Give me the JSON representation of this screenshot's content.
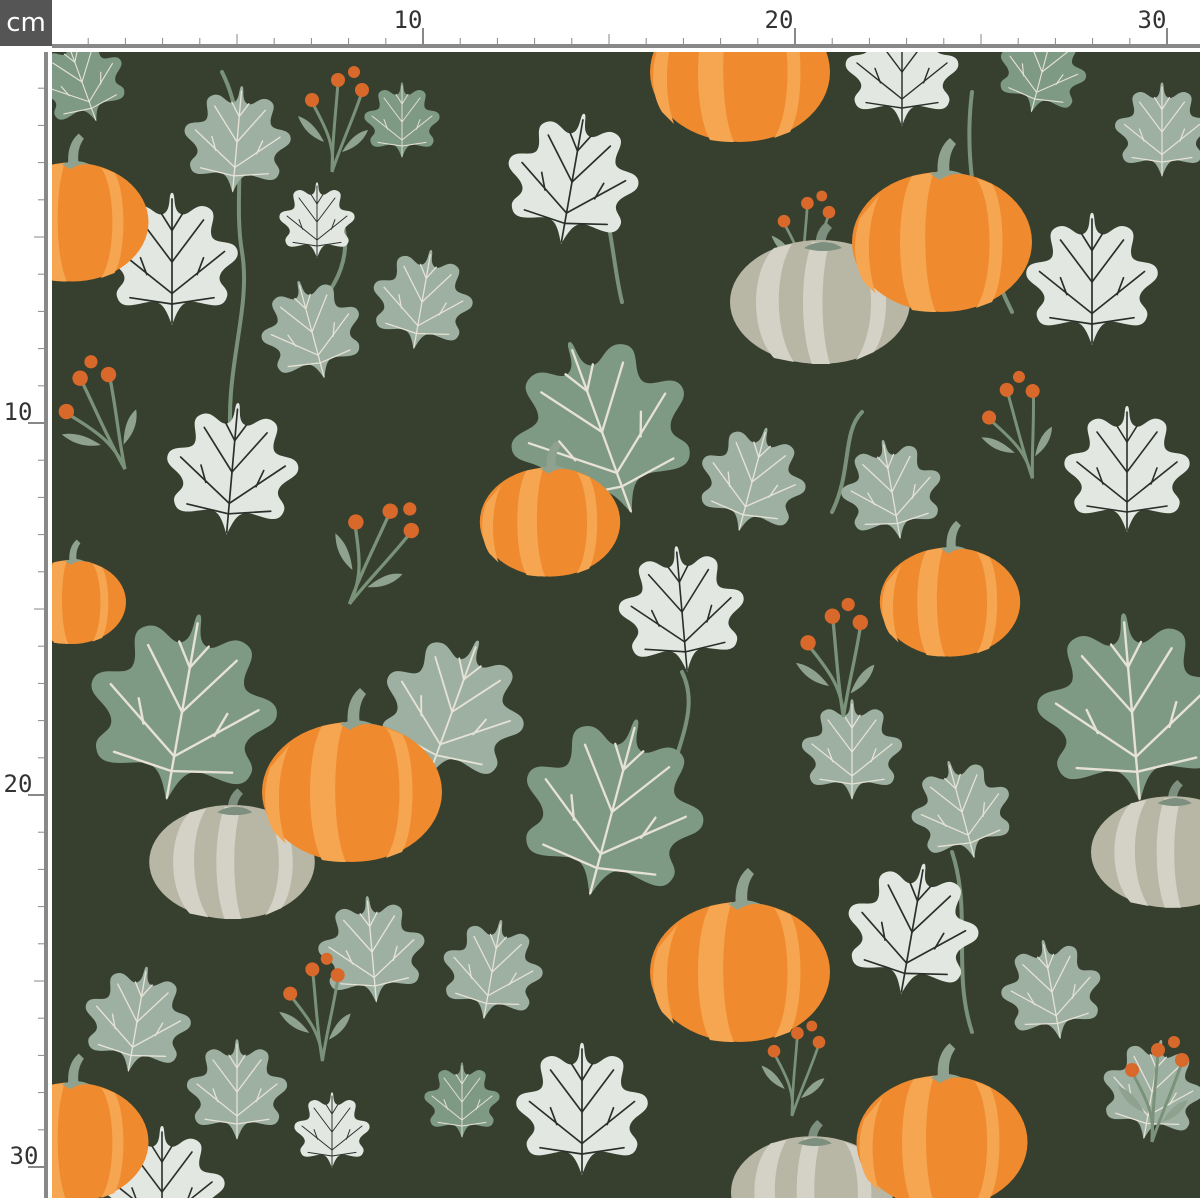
{
  "ruler": {
    "unit": "cm",
    "top_labels": [
      "10",
      "20",
      "30"
    ],
    "left_labels": [
      "10",
      "20",
      "30"
    ]
  },
  "fabric": {
    "pattern": "pumpkins-vines",
    "colors": {
      "background": "#37402f",
      "pumpkin_orange": "#ef8a2e",
      "pumpkin_light": "#f6a551",
      "pumpkin_gray": "#b8b6a5",
      "pumpkin_gray_light": "#d4d2c6",
      "stem": "#8fa290",
      "leaf_white": "#e3e7e2",
      "leaf_sage": "#7f9a84",
      "leaf_sage_light": "#9db0a2",
      "vine": "#7a9279",
      "berry": "#d9692a"
    }
  }
}
